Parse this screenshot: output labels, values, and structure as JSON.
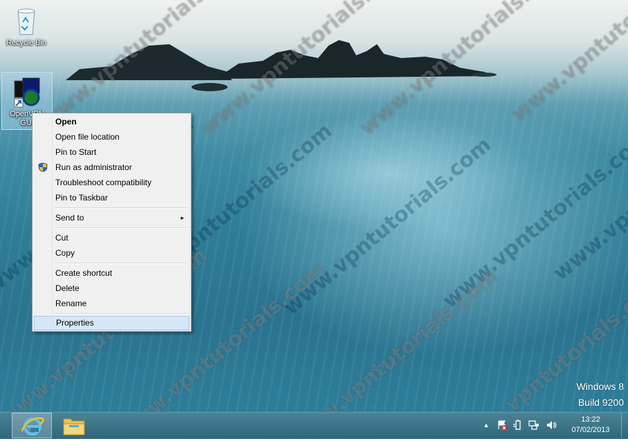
{
  "desktop": {
    "icons": [
      {
        "label": "Recycle Bin",
        "icon": "recycle-bin-icon"
      },
      {
        "label": "OpenVPN GUI",
        "icon": "openvpn-shortcut-icon",
        "selected": true
      }
    ],
    "watermark": "www.vpntutorials.com",
    "os_name": "Windows 8",
    "os_build": "Build 9200"
  },
  "context_menu": {
    "items": [
      {
        "label": "Open",
        "bold": true
      },
      {
        "label": "Open file location"
      },
      {
        "label": "Pin to Start"
      },
      {
        "label": "Run as administrator",
        "icon": "uac-shield-icon"
      },
      {
        "label": "Troubleshoot compatibility"
      },
      {
        "label": "Pin to Taskbar"
      },
      {
        "label": "Send to",
        "submenu": true
      },
      {
        "label": "Cut"
      },
      {
        "label": "Copy"
      },
      {
        "label": "Create shortcut"
      },
      {
        "label": "Delete"
      },
      {
        "label": "Rename"
      },
      {
        "label": "Properties",
        "highlighted": true
      }
    ],
    "submenu_arrow": "▸"
  },
  "taskbar": {
    "pinned": [
      {
        "name": "Internet Explorer",
        "icon": "internet-explorer-icon",
        "active": true
      },
      {
        "name": "File Explorer",
        "icon": "file-explorer-icon"
      }
    ],
    "tray": {
      "show_hidden_glyph": "▲",
      "icons": [
        "action-center-icon",
        "power-icon",
        "network-icon",
        "volume-icon"
      ],
      "time": "13:22",
      "date": "07/02/2013"
    }
  },
  "colors": {
    "menu_bg": "#f0f0f0",
    "menu_highlight": "#d5e6f7",
    "taskbar": "#2f7f97"
  }
}
